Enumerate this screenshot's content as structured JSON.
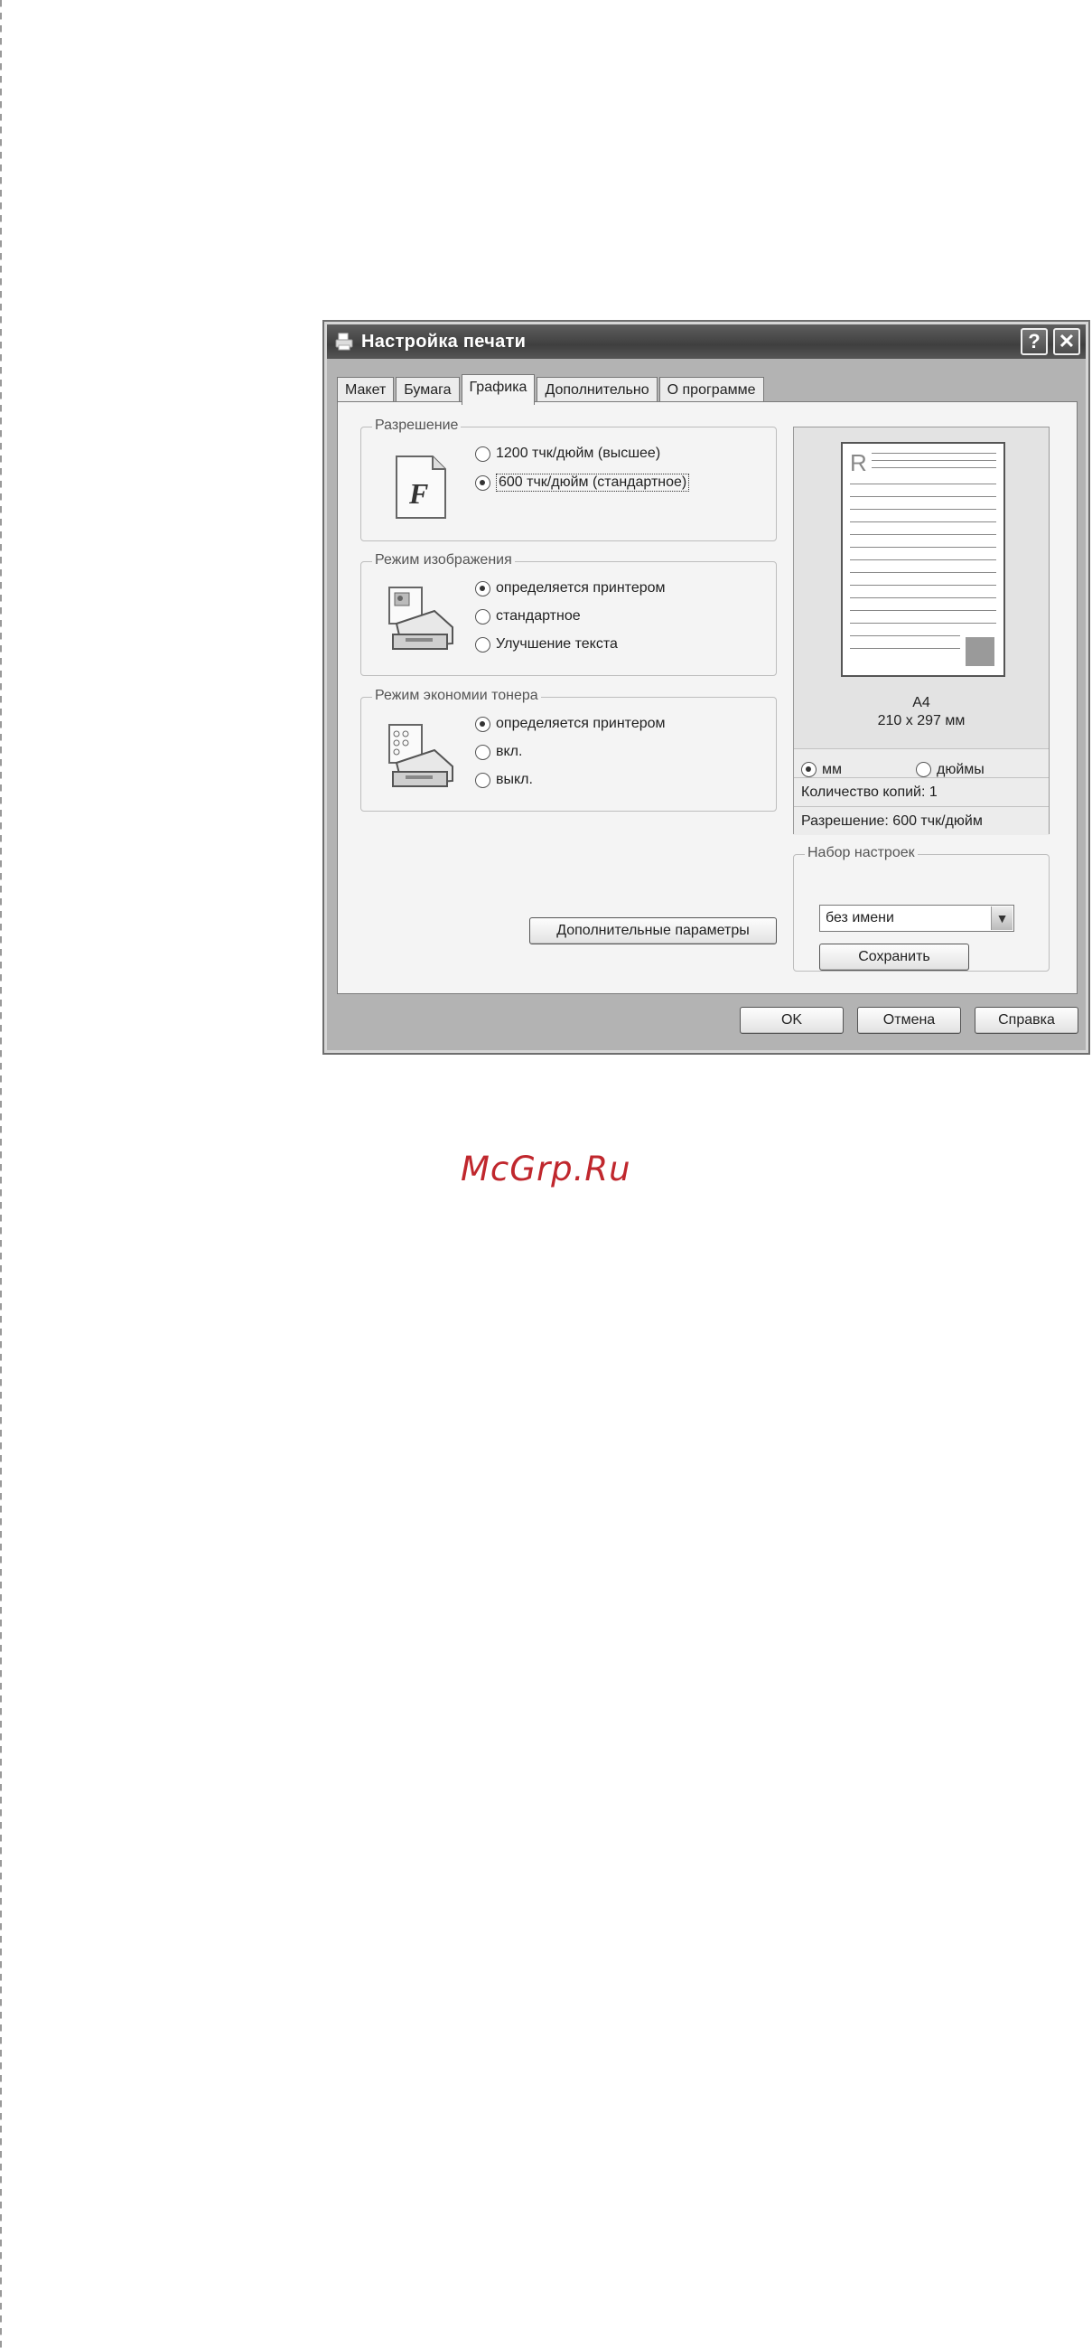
{
  "dialog": {
    "title": "Настройка печати",
    "help_label": "?",
    "close_label": "✕"
  },
  "tabs": [
    {
      "label": "Макет"
    },
    {
      "label": "Бумага"
    },
    {
      "label": "Графика",
      "active": true
    },
    {
      "label": "Дополнительно"
    },
    {
      "label": "О программе"
    }
  ],
  "resolution": {
    "legend": "Разрешение",
    "icon": "font-f-icon",
    "options": [
      {
        "label": "1200 тчк/дюйм (высшее)",
        "checked": false
      },
      {
        "label": "600 тчк/дюйм (стандартное)",
        "checked": true
      }
    ]
  },
  "image_mode": {
    "legend": "Режим изображения",
    "icon": "printer-image-icon",
    "options": [
      {
        "label": "определяется принтером",
        "checked": true
      },
      {
        "label": "стандартное",
        "checked": false
      },
      {
        "label": "Улучшение текста",
        "checked": false
      }
    ]
  },
  "toner_save": {
    "legend": "Режим экономии тонера",
    "icon": "printer-toner-icon",
    "options": [
      {
        "label": "определяется принтером",
        "checked": true
      },
      {
        "label": "вкл.",
        "checked": false
      },
      {
        "label": "выкл.",
        "checked": false
      }
    ]
  },
  "advanced_button": "Дополнительные параметры",
  "preview": {
    "page_letter": "R",
    "paper_name": "A4",
    "paper_size": "210 x 297 мм",
    "units": [
      {
        "label": "мм",
        "checked": true
      },
      {
        "label": "дюймы",
        "checked": false
      }
    ],
    "copies": "Количество копий: 1",
    "resolution": "Разрешение: 600 тчк/дюйм"
  },
  "presets": {
    "legend": "Набор настроек",
    "selected": "без имени",
    "save_label": "Сохранить"
  },
  "footer": {
    "ok": "OK",
    "cancel": "Отмена",
    "help": "Справка"
  },
  "watermark": "McGrp.Ru"
}
